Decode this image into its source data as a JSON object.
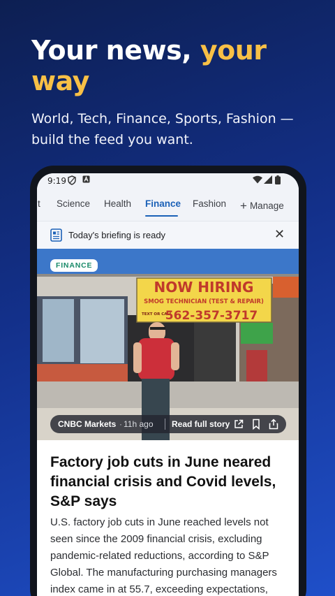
{
  "promo": {
    "headline_main": "Your news, ",
    "headline_accent_1": "your",
    "headline_accent_2": "way",
    "subhead": "World, Tech, Finance, Sports, Fashion — build the feed you want."
  },
  "status_bar": {
    "time": "9:19",
    "icons": [
      "shield-icon",
      "a-notification-icon",
      "wifi-icon",
      "signal-icon",
      "battery-icon"
    ]
  },
  "tabs": {
    "items": [
      {
        "label": "t"
      },
      {
        "label": "Science"
      },
      {
        "label": "Health"
      },
      {
        "label": "Finance",
        "active": true
      },
      {
        "label": "Fashion"
      }
    ],
    "manage_label": "Manage"
  },
  "briefing": {
    "text": "Today's briefing is ready"
  },
  "hero": {
    "tag": "FINANCE",
    "sign_line1": "NOW HIRING",
    "sign_line2": "SMOG TECHNICIAN (TEST & REPAIR)",
    "sign_text_call": "TEXT OR CALL",
    "sign_phone": "562-357-3717",
    "source": "CNBC Markets",
    "age": "11h ago",
    "read_label": "Read full story"
  },
  "article": {
    "title": "Factory job cuts in June neared financial crisis and Covid levels, S&P says",
    "body": "U.S. factory job cuts in June reached levels not seen since the 2009 financial crisis, excluding pandemic-related reductions, according to S&P Global. The manufacturing purchasing managers index came in at 55.7, exceeding expectations,"
  },
  "colors": {
    "accent_yellow": "#f8c046",
    "tab_active": "#1b61b7",
    "tag_green": "#198a69",
    "background_top": "#0d1f52",
    "background_bottom": "#1f4fc9"
  }
}
